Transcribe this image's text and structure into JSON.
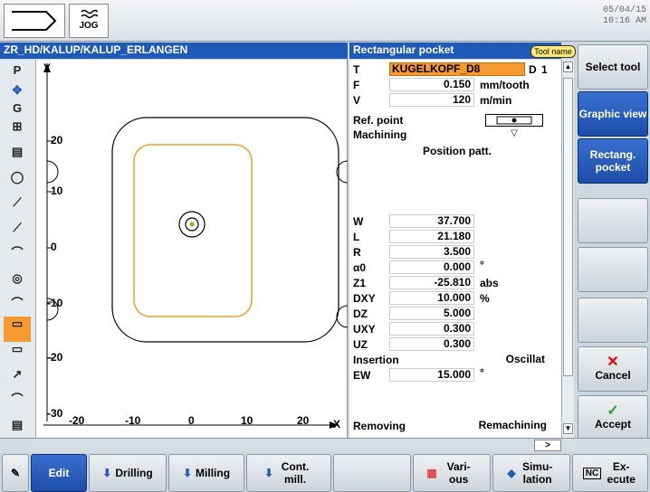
{
  "topbar": {
    "mode_label": "JOG",
    "date": "05/04/15",
    "time": "10:16 AM"
  },
  "header": {
    "path": "ZR_HD/KALUP/KALUP_ERLANGEN",
    "dialog_title": "Rectangular pocket",
    "tool_name_button": "Tool name"
  },
  "left_tools": {
    "p": "P",
    "g": "G"
  },
  "graphic": {
    "y_axis_label": "Y",
    "x_axis_label": "X",
    "y_ticks": [
      "20",
      "10",
      "0",
      "-10",
      "-20",
      "-30"
    ],
    "x_ticks": [
      "-20",
      "-10",
      "0",
      "10",
      "20"
    ]
  },
  "form": {
    "t": {
      "label": "T",
      "value": "KUGELKOPF_D8",
      "d_label": "D",
      "d_value": "1"
    },
    "f": {
      "label": "F",
      "value": "0.150",
      "unit": "mm/tooth"
    },
    "v": {
      "label": "V",
      "value": "120",
      "unit": "m/min"
    },
    "ref_point": {
      "label": "Ref. point"
    },
    "machining": {
      "label": "Machining",
      "value": "▽"
    },
    "position_patt": "Position patt.",
    "w": {
      "label": "W",
      "value": "37.700"
    },
    "l": {
      "label": "L",
      "value": "21.180"
    },
    "r": {
      "label": "R",
      "value": "3.500"
    },
    "a0": {
      "label": "α0",
      "value": "0.000",
      "unit": "°"
    },
    "z1": {
      "label": "Z1",
      "value": "-25.810",
      "unit": "abs"
    },
    "dxy": {
      "label": "DXY",
      "value": "10.000",
      "unit": "%"
    },
    "dz": {
      "label": "DZ",
      "value": "5.000"
    },
    "uxy": {
      "label": "UXY",
      "value": "0.300"
    },
    "uz": {
      "label": "UZ",
      "value": "0.300"
    },
    "insertion": {
      "label": "Insertion",
      "value": "Oscillat"
    },
    "ew": {
      "label": "EW",
      "value": "15.000",
      "unit": "°"
    },
    "removing": {
      "label": "Removing",
      "value": "Remachining"
    }
  },
  "right_softkeys": {
    "select_tool": "Select tool",
    "graphic_view": "Graphic view",
    "rectang_pocket": "Rectang. pocket",
    "cancel": "Cancel",
    "accept": "Accept"
  },
  "bottom_softkeys": {
    "edit": "Edit",
    "drilling": "Drilling",
    "milling": "Milling",
    "cont_mill": "Cont. mill.",
    "various": "Vari- ous",
    "simulation": "Simu- lation",
    "execute": "Ex- ecute"
  },
  "status": {
    "arrow": ">"
  },
  "colors": {
    "accent_blue": "#1f5ab8",
    "tool_highlight": "#f49a30",
    "pocket_orange": "#f0a020"
  }
}
